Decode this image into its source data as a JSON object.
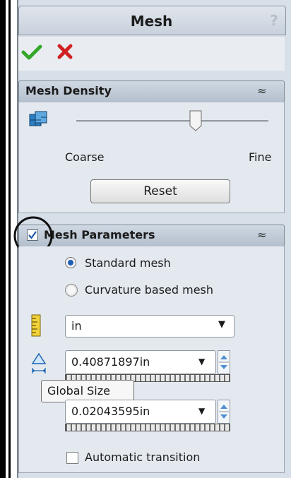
{
  "window": {
    "title": "Mesh",
    "help_label": "?"
  },
  "confirm": {
    "ok_icon": "checkmark-icon",
    "cancel_icon": "close-icon"
  },
  "mesh_density": {
    "title": "Mesh Density",
    "collapse_glyph": "≈",
    "slider_level": 0.62,
    "coarse_label": "Coarse",
    "fine_label": "Fine",
    "reset_label": "Reset"
  },
  "mesh_parameters": {
    "title": "Mesh Parameters",
    "collapse_glyph": "≈",
    "checked": true,
    "standard_label": "Standard mesh",
    "curvature_label": "Curvature based mesh",
    "unit_value": "in",
    "global_size_value": "0.40871897in",
    "tolerance_value": "0.02043595in",
    "tooltip": "Global Size",
    "auto_transition_label": "Automatic transition"
  }
}
